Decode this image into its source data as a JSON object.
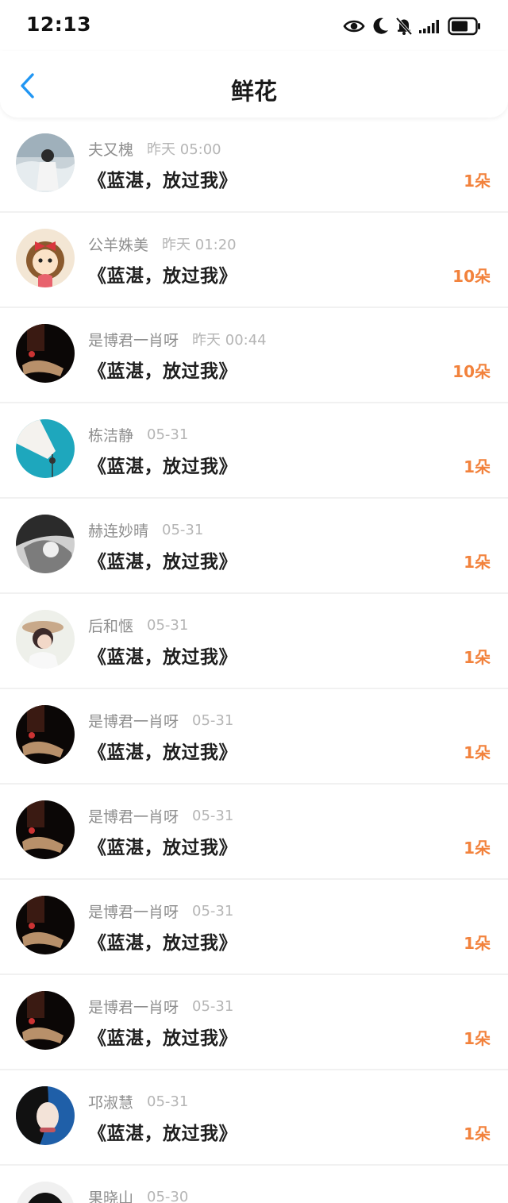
{
  "status_bar": {
    "time": "12:13",
    "icons": [
      "eye-icon",
      "moon-icon",
      "bell-off-icon",
      "signal-icon",
      "battery-icon"
    ]
  },
  "nav": {
    "back_icon": "back-chevron-icon",
    "title": "鲜花"
  },
  "colors": {
    "accent": "#f2823c",
    "back": "#2196f3"
  },
  "items": [
    {
      "name": "夫又槐",
      "time": "昨天 05:00",
      "work": "《蓝湛，放过我》",
      "count": "1朵",
      "avatar": "misty-girl"
    },
    {
      "name": "公羊姝美",
      "time": "昨天 01:20",
      "work": "《蓝湛，放过我》",
      "count": "10朵",
      "avatar": "cartoon-girl"
    },
    {
      "name": "是博君一肖呀",
      "time": "昨天 00:44",
      "work": "《蓝湛，放过我》",
      "count": "10朵",
      "avatar": "dark-scene"
    },
    {
      "name": "栋洁静",
      "time": "05-31",
      "work": "《蓝湛，放过我》",
      "count": "1朵",
      "avatar": "teal-hand"
    },
    {
      "name": "赫连妙晴",
      "time": "05-31",
      "work": "《蓝湛，放过我》",
      "count": "1朵",
      "avatar": "mono-portrait"
    },
    {
      "name": "后和惬",
      "time": "05-31",
      "work": "《蓝湛，放过我》",
      "count": "1朵",
      "avatar": "hat-girl"
    },
    {
      "name": "是博君一肖呀",
      "time": "05-31",
      "work": "《蓝湛，放过我》",
      "count": "1朵",
      "avatar": "dark-scene"
    },
    {
      "name": "是博君一肖呀",
      "time": "05-31",
      "work": "《蓝湛，放过我》",
      "count": "1朵",
      "avatar": "dark-scene"
    },
    {
      "name": "是博君一肖呀",
      "time": "05-31",
      "work": "《蓝湛，放过我》",
      "count": "1朵",
      "avatar": "dark-scene"
    },
    {
      "name": "是博君一肖呀",
      "time": "05-31",
      "work": "《蓝湛，放过我》",
      "count": "1朵",
      "avatar": "dark-scene"
    },
    {
      "name": "邛淑慧",
      "time": "05-31",
      "work": "《蓝湛，放过我》",
      "count": "1朵",
      "avatar": "blue-portrait"
    },
    {
      "name": "果晓山",
      "time": "05-30",
      "work": "",
      "count": "",
      "avatar": "penguin"
    }
  ]
}
